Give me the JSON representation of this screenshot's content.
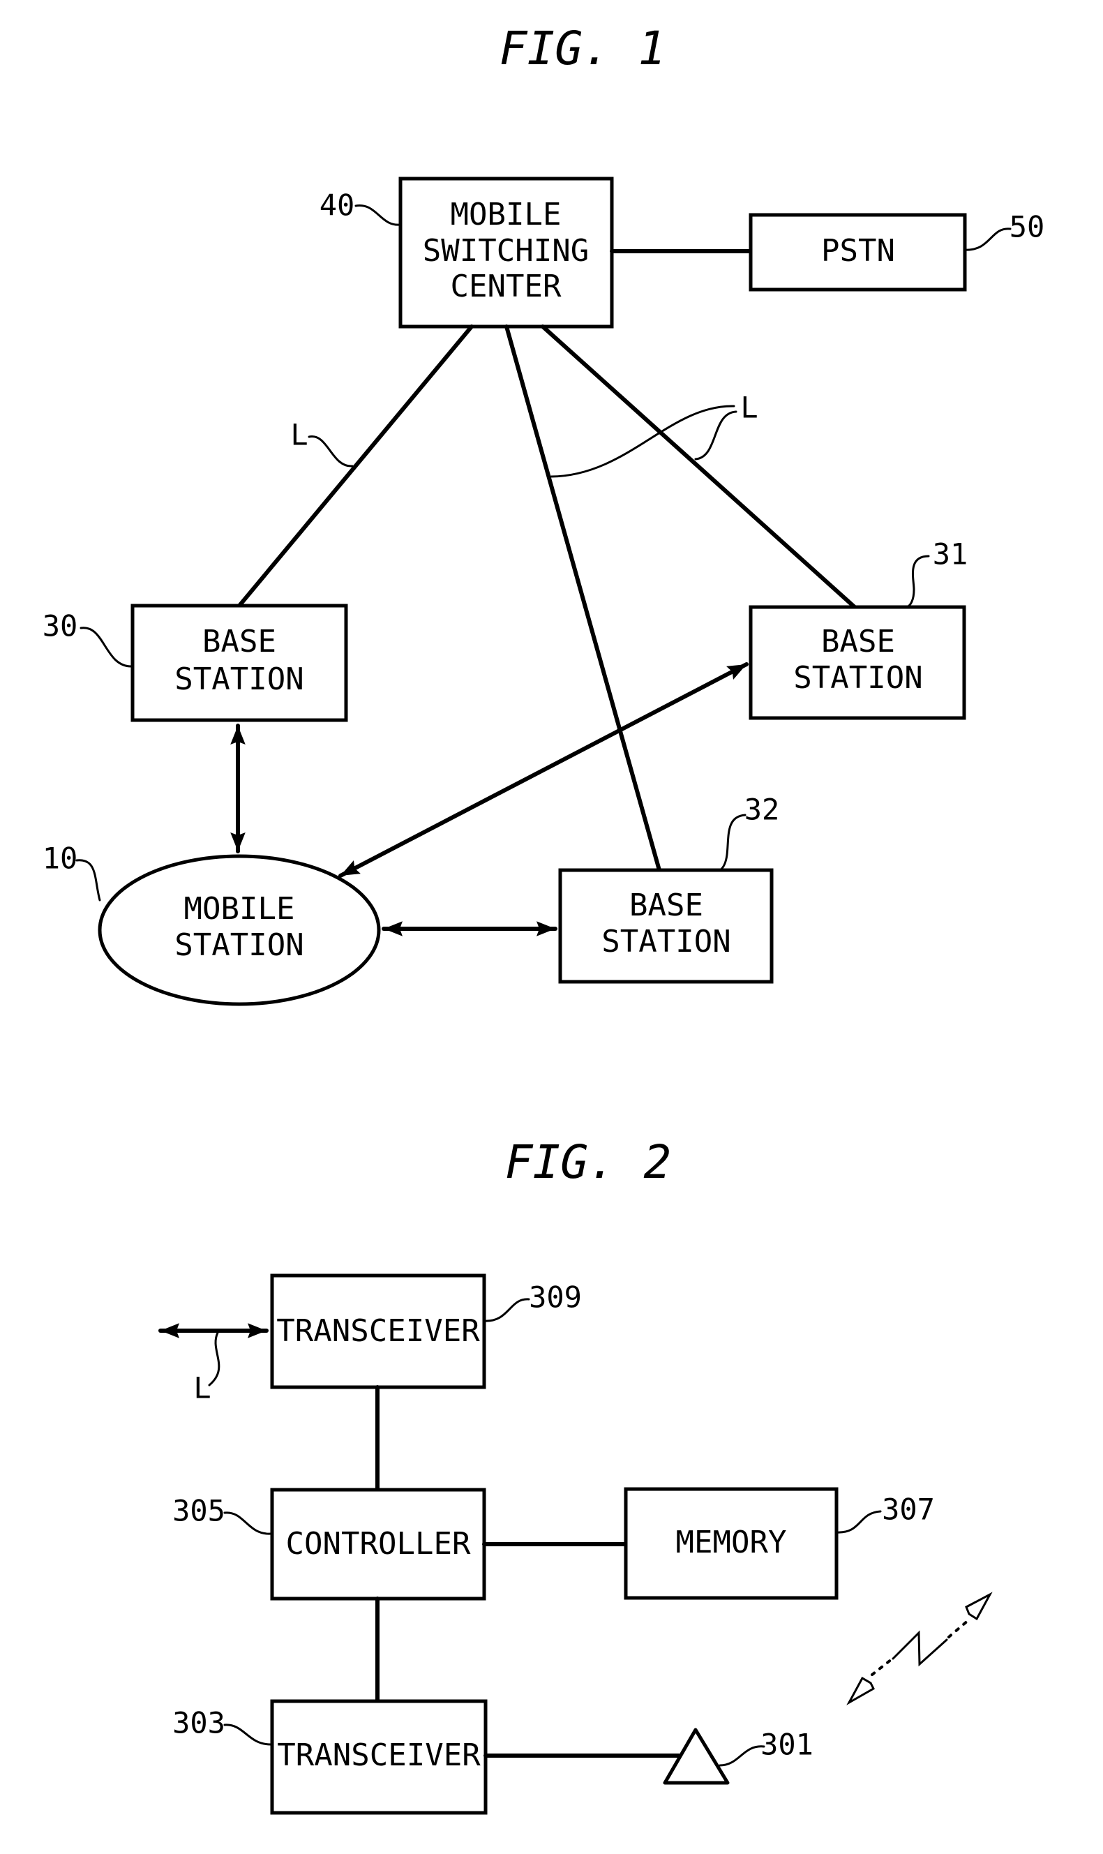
{
  "fig1": {
    "title": "FIG. 1",
    "msc": {
      "ref": "40",
      "lines": [
        "MOBILE",
        "SWITCHING",
        "CENTER"
      ]
    },
    "pstn": {
      "ref": "50",
      "label": "PSTN"
    },
    "bs30": {
      "ref": "30",
      "lines": [
        "BASE",
        "STATION"
      ]
    },
    "bs31": {
      "ref": "31",
      "lines": [
        "BASE",
        "STATION"
      ]
    },
    "bs32": {
      "ref": "32",
      "lines": [
        "BASE",
        "STATION"
      ]
    },
    "ms": {
      "ref": "10",
      "lines": [
        "MOBILE",
        "STATION"
      ]
    },
    "link_label_left": "L",
    "link_label_right": "L"
  },
  "fig2": {
    "title": "FIG. 2",
    "transceiver_top": {
      "ref": "309",
      "label": "TRANSCEIVER"
    },
    "controller": {
      "ref": "305",
      "label": "CONTROLLER"
    },
    "memory": {
      "ref": "307",
      "label": "MEMORY"
    },
    "transceiver_bottom": {
      "ref": "303",
      "label": "TRANSCEIVER"
    },
    "antenna": {
      "ref": "301"
    },
    "link_label": "L"
  }
}
